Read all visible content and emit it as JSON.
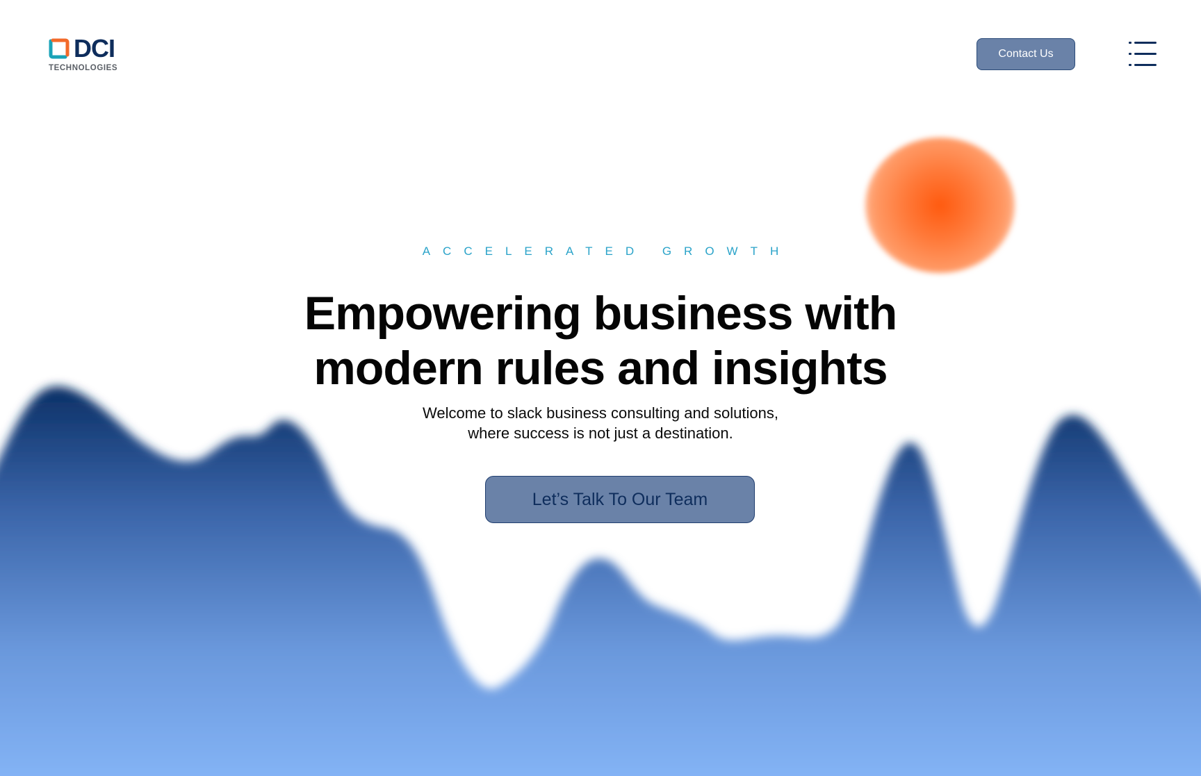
{
  "header": {
    "logo_text": "DCI",
    "logo_subtext": "TECHNOLOGIES",
    "contact_label": "Contact Us",
    "menu_icon": "hamburger-menu-icon"
  },
  "hero": {
    "eyebrow": "ACCELERATED GROWTH",
    "headline_line1": "Empowering business with",
    "headline_line2": "modern rules and insights",
    "subtext_line1": "Welcome to slack business consulting and solutions,",
    "subtext_line2": "where success is not just a destination.",
    "cta_label": "Let’s Talk To Our Team"
  },
  "colors": {
    "brand_navy": "#0e2d5c",
    "brand_teal": "#1aa3b8",
    "brand_orange": "#f26a2a",
    "button_fill": "#6a82a8",
    "eyebrow": "#2aa3c9",
    "wave_top": "#0b3066",
    "wave_bottom": "#86b6f8",
    "glow": "#ff5a0f"
  }
}
